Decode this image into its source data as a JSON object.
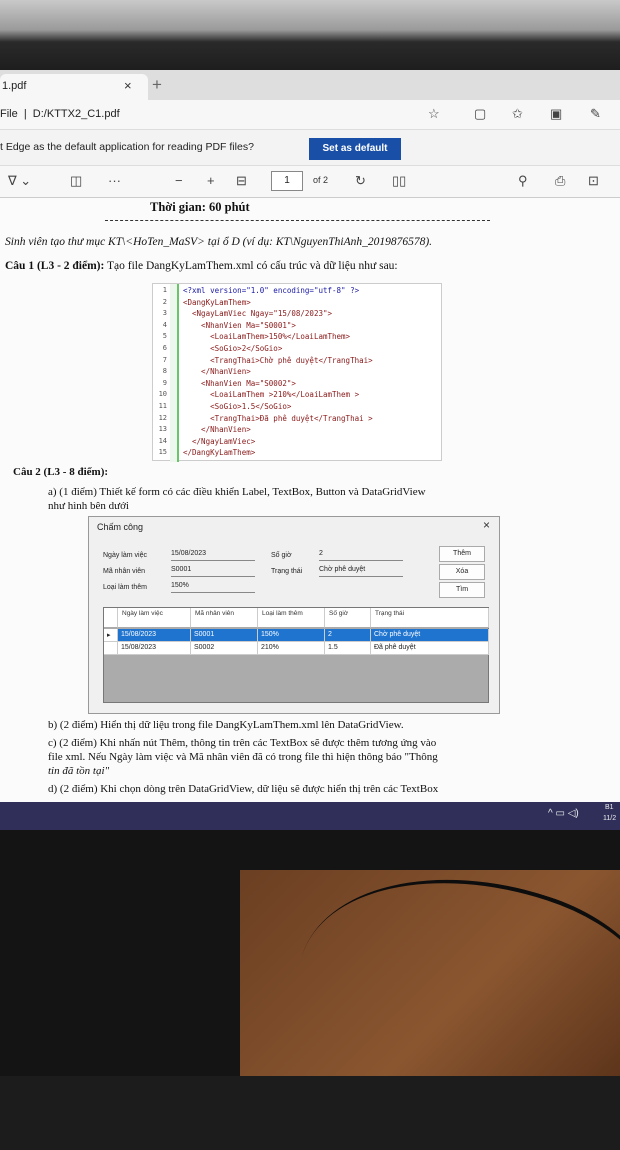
{
  "browser": {
    "tab_title": "1.pdf",
    "tab_close": "×",
    "new_tab": "+",
    "address": "File  |  D:/KTTX2_C1.pdf",
    "info_text": "t Edge as the default application for reading PDF files?",
    "set_default_label": "Set as default",
    "toolbar": {
      "minus": "−",
      "plus": "+",
      "page_current": "1",
      "page_total": "of 2"
    }
  },
  "document": {
    "time_line": "Thời gian:  60 phút",
    "instruction": "Sinh viên tạo thư mục KT\\<HoTen_MaSV> tại ổ D (ví dụ: KT\\NguyenThiAnh_2019876578).",
    "q1_heading": "Câu 1 (L3 - 2 điểm):",
    "q1_text": " Tạo file DangKyLamThem.xml có cấu trúc và dữ liệu như sau:",
    "xml_lines": [
      {
        "n": "1",
        "code": "<?xml version=\"1.0\" encoding=\"utf-8\" ?>"
      },
      {
        "n": "2",
        "code": "<DangKyLamThem>"
      },
      {
        "n": "3",
        "code": "  <NgayLamViec Ngay=\"15/08/2023\">"
      },
      {
        "n": "4",
        "code": "    <NhanVien Ma=\"S0001\">"
      },
      {
        "n": "5",
        "code": "      <LoaiLamThem>150%</LoaiLamThem>"
      },
      {
        "n": "6",
        "code": "      <SoGio>2</SoGio>"
      },
      {
        "n": "7",
        "code": "      <TrangThai>Chờ phê duyệt</TrangThai>"
      },
      {
        "n": "8",
        "code": "    </NhanVien>"
      },
      {
        "n": "9",
        "code": "    <NhanVien Ma=\"S0002\">"
      },
      {
        "n": "10",
        "code": "      <LoaiLamThem >210%</LoaiLamThem >"
      },
      {
        "n": "11",
        "code": "      <SoGio>1.5</SoGio>"
      },
      {
        "n": "12",
        "code": "      <TrangThai>Đã phê duyệt</TrangThai >"
      },
      {
        "n": "13",
        "code": "    </NhanVien>"
      },
      {
        "n": "14",
        "code": "  </NgayLamViec>"
      },
      {
        "n": "15",
        "code": "</DangKyLamThem>"
      }
    ],
    "q2_heading": "Câu 2 (L3 - 8 điểm):",
    "q2a_line1": "a) (1 điểm) Thiết kế form có các điều khiển Label, TextBox, Button và DataGridView",
    "q2a_line2": "như hình bên dưới",
    "q2b": "b) (2 điểm) Hiển thị dữ liệu trong file DangKyLamThem.xml lên DataGridView.",
    "q2c_line1": "c) (2 điểm) Khi nhấn nút Thêm, thông tin trên các TextBox sẽ được thêm tương ứng vào",
    "q2c_line2": "file xml. Nếu Ngày làm việc và Mã nhân viên đã có trong file thì hiện thông báo \"Thông",
    "q2c_line3": "tin đã tồn tại\"",
    "q2d": "d) (2 điểm) Khi chọn dòng trên DataGridView, dữ liệu sẽ được hiển thị trên các TextBox"
  },
  "form": {
    "title": "Chấm công",
    "close": "×",
    "labels": {
      "ngay": "Ngày làm việc",
      "ma": "Mã nhân viên",
      "loai": "Loại làm thêm",
      "sogio": "Số giờ",
      "trangthai": "Trạng thái"
    },
    "values": {
      "ngay": "15/08/2023",
      "ma": "S0001",
      "loai": "150%",
      "sogio": "2",
      "trangthai": "Chờ phê duyệt"
    },
    "buttons": {
      "them": "Thêm",
      "xoa": "Xóa",
      "tim": "Tìm"
    },
    "grid": {
      "headers": [
        "Ngày làm việc",
        "Mã nhân viên",
        "Loại làm thêm",
        "Số giờ",
        "Trạng thái"
      ],
      "rows": [
        [
          "15/08/2023",
          "S0001",
          "150%",
          "2",
          "Chờ phê duyệt"
        ],
        [
          "15/08/2023",
          "S0002",
          "210%",
          "1.5",
          "Đã phê duyệt"
        ]
      ],
      "row_indicator": "▸"
    }
  },
  "taskbar": {
    "tray": "^ ▭ ◁)",
    "clock_day": "B1",
    "clock_date": "11/2"
  }
}
